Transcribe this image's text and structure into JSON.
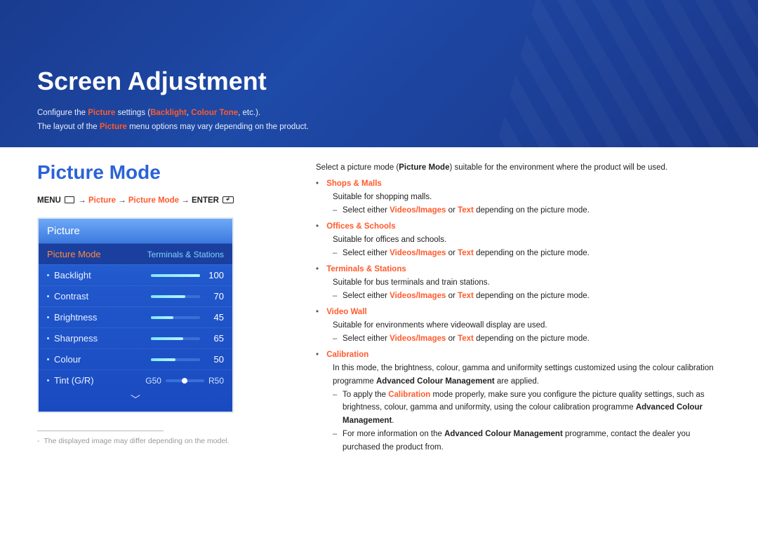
{
  "header": {
    "title": "Screen Adjustment",
    "sub_pre": "Configure the ",
    "sub_picture": "Picture",
    "sub_mid": " settings (",
    "sub_backlight": "Backlight",
    "sub_comma": ", ",
    "sub_tone": "Colour Tone",
    "sub_post": ", etc.).",
    "sub_line2_pre": "The layout of the ",
    "sub_line2_post": " menu options may vary depending on the product."
  },
  "section": {
    "title": "Picture Mode",
    "breadcrumb": {
      "menu": "MENU",
      "arrow": "→",
      "p1": "Picture",
      "p2": "Picture Mode",
      "enter": "ENTER"
    }
  },
  "osd": {
    "title": "Picture",
    "mode_label": "Picture Mode",
    "mode_value": "Terminals & Stations",
    "items": [
      {
        "label": "Backlight",
        "value": "100",
        "fill": 100
      },
      {
        "label": "Contrast",
        "value": "70",
        "fill": 70
      },
      {
        "label": "Brightness",
        "value": "45",
        "fill": 45
      },
      {
        "label": "Sharpness",
        "value": "65",
        "fill": 65
      },
      {
        "label": "Colour",
        "value": "50",
        "fill": 50
      }
    ],
    "tint": {
      "label": "Tint (G/R)",
      "g": "G50",
      "r": "R50"
    }
  },
  "footnote": {
    "dash": "-",
    "text": "The displayed image may differ depending on the model."
  },
  "right": {
    "intro_pre": "Select a picture mode (",
    "intro_bold": "Picture Mode",
    "intro_post": ") suitable for the environment where the product will be used.",
    "bullet_dot": "•",
    "modes": [
      {
        "name": "Shops & Malls",
        "desc": "Suitable for shopping malls.",
        "subs": [
          "Select either Videos/Images or Text depending on the picture mode."
        ]
      },
      {
        "name": "Offices & Schools",
        "desc": "Suitable for offices and schools.",
        "subs": [
          "Select either Videos/Images or Text depending on the picture mode."
        ]
      },
      {
        "name": "Terminals & Stations",
        "desc": "Suitable for bus terminals and train stations.",
        "subs": [
          "Select either Videos/Images or Text depending on the picture mode."
        ]
      },
      {
        "name": "Video Wall",
        "desc": "Suitable for environments where videowall display are used.",
        "subs": [
          "Select either Videos/Images or Text depending on the picture mode."
        ]
      }
    ],
    "calibration": {
      "name": "Calibration",
      "desc_pre": "In this mode, the brightness, colour, gamma and uniformity settings customized using the colour calibration programme ",
      "desc_bold": "Advanced Colour Management",
      "desc_post": " are applied.",
      "sub1_pre": "To apply the ",
      "sub1_cal": "Calibration",
      "sub1_mid": " mode properly, make sure you configure the picture quality settings, such as brightness, colour, gamma and uniformity, using the colour calibration programme ",
      "sub1_bold": "Advanced Colour Management",
      "sub1_post": ".",
      "sub2_pre": "For more information on the ",
      "sub2_bold": "Advanced Colour Management",
      "sub2_post": " programme, contact the dealer you purchased the product from."
    },
    "sub_vi": "Videos/Images",
    "sub_or": " or ",
    "sub_text": "Text",
    "sub_prefix": "Select either ",
    "sub_suffix": " depending on the picture mode."
  }
}
